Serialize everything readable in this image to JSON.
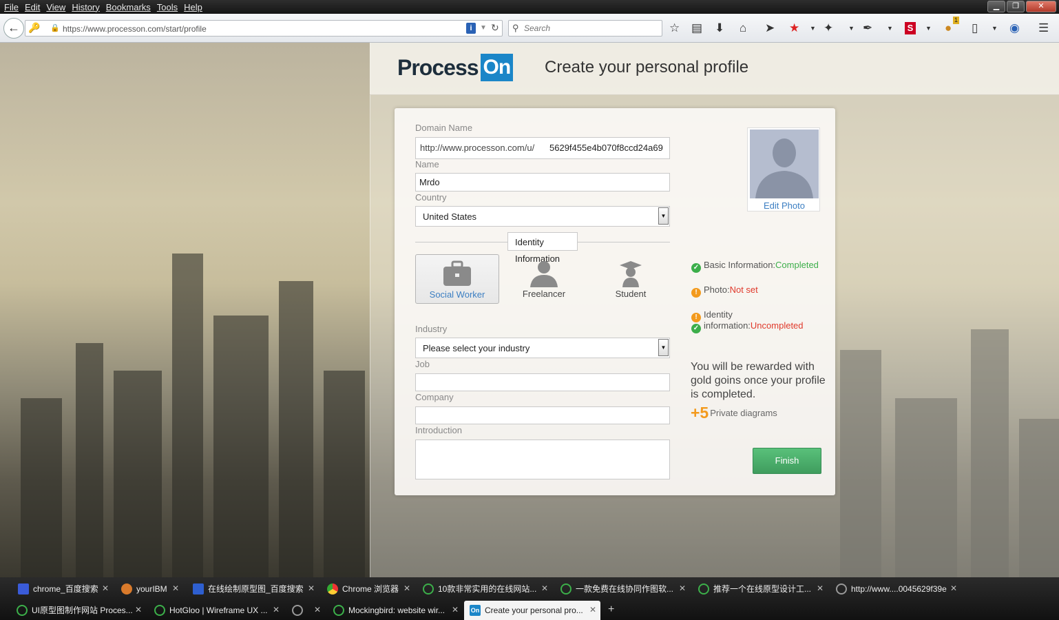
{
  "menu": [
    "File",
    "Edit",
    "View",
    "History",
    "Bookmarks",
    "Tools",
    "Help"
  ],
  "window_controls": {
    "minimize": "▁",
    "restore": "❐",
    "close": "✕"
  },
  "nav": {
    "url": "https://www.processon.com/start/profile",
    "search_placeholder": "Search",
    "back_icon": "arrow-left",
    "toolbar_icons": [
      "star-icon",
      "clipboard-icon",
      "download-icon",
      "home-icon",
      "send-icon",
      "bookmark-star-icon",
      "dropdown-icon",
      "addon-icon",
      "dropdown-icon",
      "pen-icon",
      "dropdown-icon",
      "s-icon",
      "dropdown-icon",
      "notify-icon",
      "battery-icon",
      "dropdown-icon",
      "globe-icon",
      "menu-icon"
    ],
    "notify_badge": "1"
  },
  "brand": {
    "process": "Process",
    "on": "On",
    "accent": "#1b86c8"
  },
  "page_title": "Create your personal profile",
  "form": {
    "domain": {
      "label": "Domain Name",
      "prefix": "http://www.processon.com/u/",
      "value": "5629f455e4b070f8ccd24a69"
    },
    "name": {
      "label": "Name",
      "value": "Mrdo"
    },
    "country": {
      "label": "Country",
      "value": "United States"
    },
    "identity_tab": {
      "line1": "Identity",
      "line2": "Information"
    },
    "roles": [
      {
        "label": "Social Worker",
        "icon": "briefcase-icon",
        "selected": true
      },
      {
        "label": "Freelancer",
        "icon": "person-icon",
        "selected": false
      },
      {
        "label": "Student",
        "icon": "graduate-icon",
        "selected": false
      }
    ],
    "industry": {
      "label": "Industry",
      "value": "Please select your industry"
    },
    "job": {
      "label": "Job",
      "value": ""
    },
    "company": {
      "label": "Company",
      "value": ""
    },
    "introduction": {
      "label": "Introduction",
      "value": ""
    }
  },
  "photo": {
    "edit_label": "Edit Photo"
  },
  "status": {
    "basic": {
      "label": "Basic Information:",
      "value": "Completed"
    },
    "photo": {
      "label": "Photo:",
      "value": "Not set"
    },
    "identity": {
      "line1": "Identity",
      "label": "information:",
      "value": "Uncompleted"
    }
  },
  "reward": {
    "text": "You will be rewarded with gold goins once your profile is completed.",
    "plus": "+5",
    "item": "Private diagrams"
  },
  "finish_label": "Finish",
  "tabs": [
    {
      "title": "chrome_百度搜索",
      "icon": "blue"
    },
    {
      "title": "yourIBM",
      "icon": "ibm"
    },
    {
      "title": "在线绘制原型图_百度搜索",
      "icon": "paw"
    },
    {
      "title": "Chrome 浏览器",
      "icon": "chrome"
    },
    {
      "title": "10款非常实用的在线网站...",
      "icon": "ring"
    },
    {
      "title": "一款免费在线协同作图软...",
      "icon": "ring"
    },
    {
      "title": "推荐一个在线原型设计工...",
      "icon": "ring"
    },
    {
      "title": "http://www....0045629f39e",
      "icon": "load"
    },
    {
      "title": "UI原型图制作网站 Proces...",
      "icon": "ring"
    },
    {
      "title": "HotGloo | Wireframe UX ...",
      "icon": "ring"
    },
    {
      "title": "",
      "icon": "load"
    },
    {
      "title": "Mockingbird: website wir...",
      "icon": "ring"
    },
    {
      "title": "Create your personal pro...",
      "icon": "on",
      "active": true
    }
  ],
  "tab_close": "✕",
  "new_tab": "+"
}
